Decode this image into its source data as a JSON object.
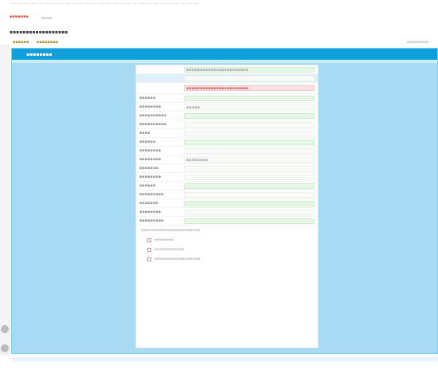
{
  "browser": {
    "title_line": "— — — — — — — — — — — — — — — — — — — — — — — — — — — —"
  },
  "header": {
    "tag": "▪▪▪▪▪▪▪",
    "tag2": "▪▪▪▪",
    "site_title": "▪▪▪▪▪▪▪▪▪▪▪▪▪▪▪▪▪▪",
    "menu_items": [
      "▪▪▪▪▪▪",
      "▪▪▪▪▪▪▪▪"
    ],
    "menu_right": "▪▪▪▪▪▪▪▪"
  },
  "panel": {
    "title": "▪▪▪▪▪▪▪▪"
  },
  "form": {
    "rows": [
      {
        "label": "",
        "value": "▪▪▪▪▪▪▪▪▪▪▪▪▪▪▪▪▪▪▪▪▪▪▪",
        "style": "green"
      },
      {
        "label": "",
        "value": "",
        "style": "blue"
      },
      {
        "label": "",
        "value": "▪▪▪▪▪▪▪▪▪▪▪▪▪▪▪▪▪▪▪▪▪▪▪",
        "style": "alert"
      },
      {
        "label": "▪▪▪▪▪▪",
        "value": "",
        "style": "green"
      },
      {
        "label": "▪▪▪▪▪▪▪▪",
        "value": "▪▪▪▪▪",
        "style": "plain"
      },
      {
        "label": "▪▪▪▪▪▪▪▪▪▪",
        "value": "",
        "style": "green"
      },
      {
        "label": "▪▪▪▪▪▪▪▪▪▪",
        "value": "",
        "style": "plain"
      },
      {
        "label": "▪▪▪▪",
        "value": "",
        "style": "plain"
      },
      {
        "label": "▪▪▪▪▪▪",
        "value": "",
        "style": "green"
      },
      {
        "label": "▪▪▪▪▪▪▪▪",
        "value": "",
        "style": "plain"
      },
      {
        "label": "▪▪▪▪▪▪▪▪",
        "value": "▪▪▪▪▪▪▪▪",
        "style": "plain"
      },
      {
        "label": "▪▪▪▪▪▪▪",
        "value": "",
        "style": "plain"
      },
      {
        "label": "▪▪▪▪▪▪▪▪",
        "value": "",
        "style": "plain"
      },
      {
        "label": "▪▪▪▪▪▪",
        "value": "",
        "style": "green"
      },
      {
        "label": "▪▪▪▪▪▪▪▪▪",
        "value": "",
        "style": "plain"
      },
      {
        "label": "▪▪▪▪▪▪▪",
        "value": "",
        "style": "green"
      },
      {
        "label": "▪▪▪▪▪▪▪▪",
        "value": "",
        "style": "plain"
      },
      {
        "label": "▪▪▪▪▪▪▪▪▪",
        "value": "",
        "style": "green"
      }
    ],
    "checkbox_header": "▪▪▪▪▪▪▪▪▪▪▪▪▪▪▪▪▪▪▪▪▪▪",
    "checkboxes": [
      "▪▪▪▪▪▪▪",
      "▪▪▪▪▪▪▪▪▪▪▪",
      "▪▪▪▪▪▪▪▪▪▪▪▪▪▪▪▪▪"
    ]
  },
  "colors": {
    "panel_bg": "#a9dbf5",
    "panel_header": "#11a0dc",
    "alert": "#fde3e3"
  }
}
